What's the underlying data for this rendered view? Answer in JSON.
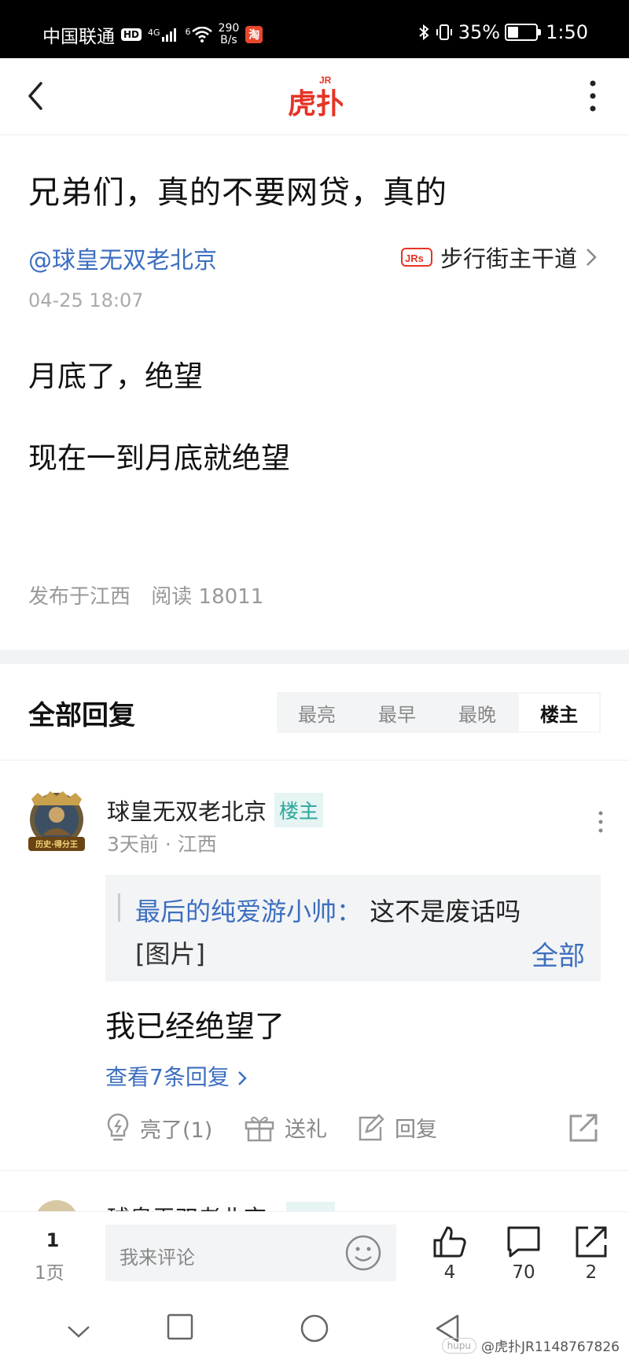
{
  "status_bar": {
    "carrier": "中国联通",
    "hd": "HD",
    "network": "4G",
    "network2": "6",
    "speed_value": "290",
    "speed_unit": "B/s",
    "taobao": "淘",
    "battery_percent": "35%",
    "battery_level": 0.35,
    "time": "1:50"
  },
  "nav": {
    "logo_text": "虎扑",
    "logo_badge": "JR"
  },
  "post": {
    "title": "兄弟们，真的不要网贷，真的",
    "author": "@球皇无双老北京",
    "forum_badge": "JRs",
    "forum": "步行街主干道",
    "time": "04-25 18:07",
    "body": [
      "月底了，绝望",
      "现在一到月底就绝望"
    ],
    "location": "发布于江西",
    "reads": "阅读 18011"
  },
  "replies": {
    "header": "全部回复",
    "sort_tabs": [
      "最亮",
      "最早",
      "最晚",
      "楼主"
    ],
    "active_tab": "楼主"
  },
  "reply1": {
    "avatar_text": "历史·得分王",
    "user": "球皇无双老北京",
    "badge": "楼主",
    "time_location": "3天前 · 江西",
    "quote_author": "最后的纯爱游小帅：",
    "quote_text": "这不是废话吗",
    "quote_image": "[图片]",
    "quote_all": "全部",
    "body": "我已经绝望了",
    "view_replies": "查看7条回复",
    "actions": {
      "light": "亮了(1)",
      "gift": "送礼",
      "reply": "回复"
    }
  },
  "reply2_partial": {
    "user": "球皇无双老北京"
  },
  "comment_bar": {
    "page_num": "1",
    "page_label": "1页",
    "placeholder": "我来评论",
    "likes": "4",
    "comments": "70",
    "shares": "2"
  },
  "watermark": {
    "logo": "hupu",
    "text": "@虎扑JR1148767826"
  },
  "colors": {
    "link_blue": "#3d6fbf",
    "op_green": "#2aa79b",
    "brand_red": "#e63324"
  }
}
